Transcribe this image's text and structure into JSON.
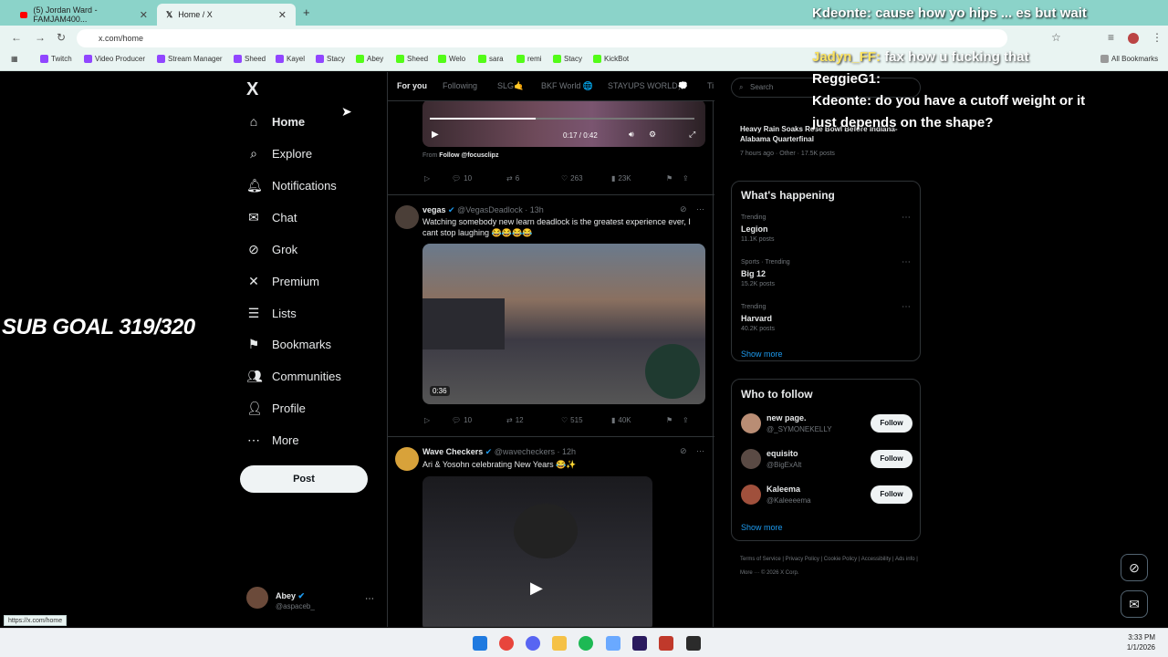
{
  "browser": {
    "tabs": [
      {
        "title": "(5) Jordan Ward - FAMJAM400..."
      },
      {
        "title": "Home / X"
      }
    ],
    "new_tab": "+",
    "url": "x.com/home",
    "bookmarks": [
      "Twitch",
      "Video Producer",
      "Stream Manager",
      "Sheed",
      "Kayel",
      "Stacy",
      "Abey",
      "Sheed",
      "Welo",
      "sara",
      "remi",
      "Stacy",
      "KickBot"
    ],
    "all_bookmarks": "All Bookmarks",
    "status_url": "https://x.com/home"
  },
  "sidebar": {
    "logo": "X",
    "items": [
      {
        "label": "Home",
        "icon": "home-icon"
      },
      {
        "label": "Explore",
        "icon": "search-icon"
      },
      {
        "label": "Notifications",
        "icon": "bell-icon"
      },
      {
        "label": "Chat",
        "icon": "mail-icon"
      },
      {
        "label": "Grok",
        "icon": "grok-icon"
      },
      {
        "label": "Premium",
        "icon": "x-icon"
      },
      {
        "label": "Lists",
        "icon": "list-icon"
      },
      {
        "label": "Bookmarks",
        "icon": "bookmark-icon"
      },
      {
        "label": "Communities",
        "icon": "people-icon"
      },
      {
        "label": "Profile",
        "icon": "person-icon"
      },
      {
        "label": "More",
        "icon": "more-icon"
      }
    ],
    "post_label": "Post",
    "account_name": "Abey",
    "account_handle": "@aspaceb_"
  },
  "timeline": {
    "tabs": [
      "For you",
      "Following",
      "SLG🤙",
      "BKF World 🌐",
      "STAYUPS WORLD💭",
      "Ti"
    ],
    "tweet1": {
      "video_time": "0:17 / 0:42",
      "from_label": "From",
      "from_link": "Follow @focusclipz",
      "replies": "10",
      "reposts": "6",
      "likes": "263",
      "views": "23K"
    },
    "tweet2": {
      "name": "vegas",
      "handle": "@VegasDeadlock · 13h",
      "text": "Watching somebody new learn deadlock is the greatest experience ever, I cant stop laughing 😂😂😂😂",
      "video_time": "0:36",
      "replies": "10",
      "reposts": "12",
      "likes": "515",
      "views": "40K"
    },
    "tweet3": {
      "name": "Wave Checkers",
      "handle": "@wavecheckers · 12h",
      "text": "Ari & Yosohn celebrating New Years 😂✨"
    }
  },
  "right": {
    "search_placeholder": "Search",
    "top_news_title": "Heavy Rain Soaks Rose Bowl Before Indiana-Alabama Quarterfinal",
    "top_news_meta": "7 hours ago · Other · 17.5K posts",
    "happening_title": "What's happening",
    "trends": [
      {
        "meta": "Trending",
        "name": "Legion",
        "posts": "11.1K posts"
      },
      {
        "meta": "Sports · Trending",
        "name": "Big 12",
        "posts": "15.2K posts"
      },
      {
        "meta": "Trending",
        "name": "Harvard",
        "posts": "40.2K posts"
      }
    ],
    "show_more": "Show more",
    "who_title": "Who to follow",
    "who": [
      {
        "name": "new page.",
        "handle": "@_SYMONEKELLY"
      },
      {
        "name": "equisito",
        "handle": "@BigExAlt"
      },
      {
        "name": "Kaleema",
        "handle": "@Kaleeeema"
      }
    ],
    "follow_label": "Follow",
    "footer": "Terms of Service | Privacy Policy | Cookie Policy | Accessibility | Ads info | More ··· © 2026 X Corp."
  },
  "overlay": {
    "sub_goal": "SUB GOAL 319/320",
    "chat": [
      {
        "user": "Kdeonte:",
        "msg": "cause how yo hips ... es but wait"
      },
      {
        "user": "Jadyn_FF:",
        "msg": "fax how u fucking that"
      },
      {
        "user": "ReggieG1:",
        "msg": ""
      },
      {
        "user": "Kdeonte:",
        "msg": "do you have a cutoff weight or it"
      },
      {
        "user": "",
        "msg": "just depends on the shape?"
      }
    ]
  },
  "taskbar": {
    "time": "3:33 PM",
    "date": "1/1/2026"
  },
  "colors": {
    "accent": "#1d9bf0",
    "chrome": "#8bd3c9",
    "bg": "#000000"
  }
}
